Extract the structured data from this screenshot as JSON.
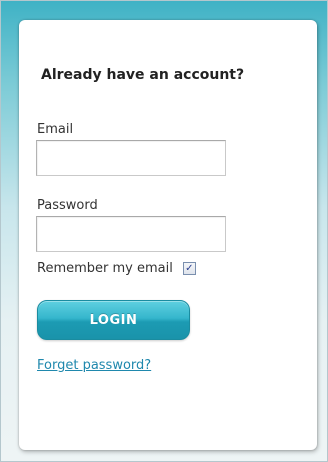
{
  "login": {
    "heading": "Already have an account?",
    "email_label": "Email",
    "email_value": "",
    "password_label": "Password",
    "password_value": "",
    "remember_label": "Remember my email",
    "remember_checked": true,
    "checkbox_icon": "check-icon",
    "login_button": "LOGIN",
    "forgot_link": "Forget password?"
  },
  "colors": {
    "accent": "#2db0c6",
    "link": "#1f88ad",
    "card": "#ffffff"
  }
}
